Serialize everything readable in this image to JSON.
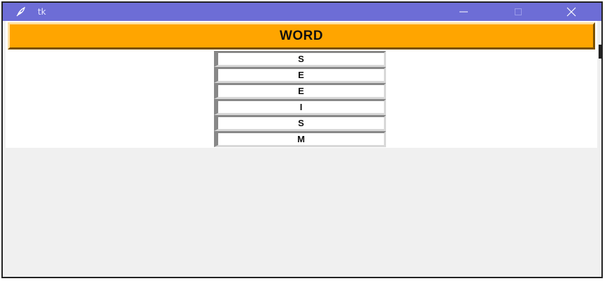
{
  "window": {
    "title": "tk",
    "title_bar_color": "#6d6dd6",
    "icon": "feather-icon",
    "controls": [
      "minimize-icon",
      "maximize-icon",
      "close-icon"
    ]
  },
  "header": {
    "label": "WORD",
    "color": "#ffa500"
  },
  "letters": [
    "S",
    "E",
    "E",
    "I",
    "S",
    "M"
  ]
}
